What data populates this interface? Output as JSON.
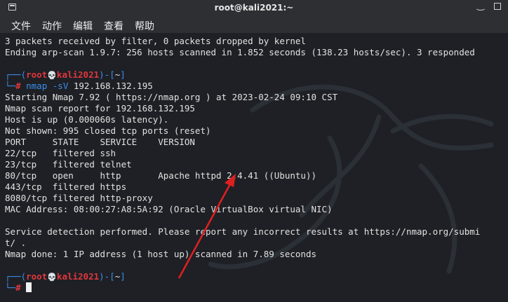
{
  "window": {
    "title": "root@kali2021:~"
  },
  "menu": [
    "文件",
    "动作",
    "编辑",
    "查看",
    "帮助"
  ],
  "prompt": {
    "open": "┌──(",
    "user": "root",
    "skull": "💀",
    "host": "kali2021",
    "mid": ")-[",
    "path": "~",
    "close": "]",
    "corner": "└─",
    "hash": "#"
  },
  "command": {
    "name": "nmap",
    "flag": "-sV",
    "target": "192.168.132.195"
  },
  "lines_top": [
    "3 packets received by filter, 0 packets dropped by kernel",
    "Ending arp-scan 1.9.7: 256 hosts scanned in 1.852 seconds (138.23 hosts/sec). 3 responded"
  ],
  "output": [
    "Starting Nmap 7.92 ( https://nmap.org ) at 2023-02-24 09:10 CST",
    "Nmap scan report for 192.168.132.195",
    "Host is up (0.000060s latency).",
    "Not shown: 995 closed tcp ports (reset)",
    "PORT     STATE    SERVICE    VERSION",
    "22/tcp   filtered ssh",
    "23/tcp   filtered telnet",
    "80/tcp   open     http       Apache httpd 2.4.41 ((Ubuntu))",
    "443/tcp  filtered https",
    "8080/tcp filtered http-proxy",
    "MAC Address: 08:00:27:A8:5A:92 (Oracle VirtualBox virtual NIC)",
    "",
    "Service detection performed. Please report any incorrect results at https://nmap.org/submi",
    "t/ .",
    "Nmap done: 1 IP address (1 host up) scanned in 7.89 seconds"
  ],
  "colors": {
    "prompt_blue": "#3b8eea",
    "prompt_red": "#e0373c",
    "arrow": "#e02020"
  }
}
